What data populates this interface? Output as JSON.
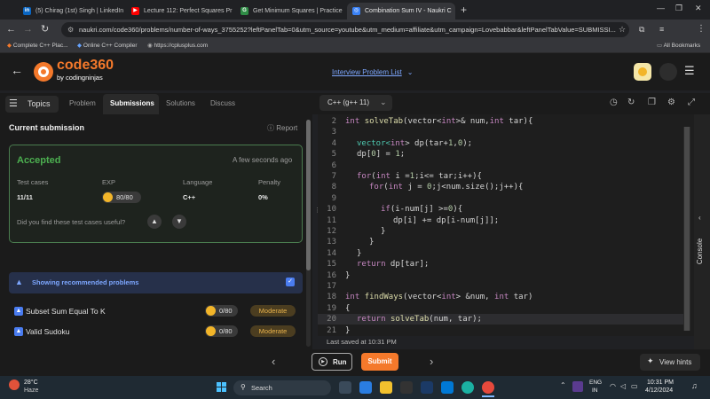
{
  "browser": {
    "tabs": [
      {
        "title": "(5) Chirag (1st) Singh | LinkedIn",
        "color": "#0a66c2",
        "glyph": "in"
      },
      {
        "title": "Lecture 112: Perfect Squares Pr",
        "color": "#ff0000",
        "glyph": "▶"
      },
      {
        "title": "Get Minimum Squares | Practice",
        "color": "#2f8d46",
        "glyph": "G"
      },
      {
        "title": "Combination Sum IV - Naukri C",
        "color": "#3b82f6",
        "glyph": "◎"
      }
    ],
    "new_tab_symbol": "+",
    "url": "naukri.com/code360/problems/number-of-ways_3755252?leftPanelTab=0&utm_source=youtube&utm_medium=affiliate&utm_campaign=Lovebabbar&leftPanelTabValue=SUBMISSI...",
    "bookmarks": [
      "Complete C++ Plac...",
      "Online C++ Compiler",
      "https://cplusplus.com"
    ],
    "all_bookmarks": "All Bookmarks"
  },
  "site": {
    "logo_main": "code360",
    "logo_sub": "by codingninjas",
    "interview_list": "Interview Problem List"
  },
  "problem_tabs": {
    "topics": "Topics",
    "problem": "Problem",
    "submissions": "Submissions",
    "solutions": "Solutions",
    "discuss": "Discuss"
  },
  "language_select": "C++ (g++ 11)",
  "submission": {
    "heading": "Current submission",
    "report": "Report",
    "status": "Accepted",
    "time_ago": "A few seconds ago",
    "test_cases_label": "Test cases",
    "test_cases_value": "11/11",
    "exp_label": "EXP",
    "exp_value": "80/80",
    "language_label": "Language",
    "language_value": "C++",
    "penalty_label": "Penalty",
    "penalty_value": "0%",
    "feedback_question": "Did you find these test cases useful?"
  },
  "recommended": {
    "banner": "Showing recommended problems",
    "items": [
      {
        "name": "Subset Sum Equal To K",
        "exp": "0/80",
        "difficulty": "Moderate"
      },
      {
        "name": "Valid Sudoku",
        "exp": "0/80",
        "difficulty": "Moderate"
      }
    ]
  },
  "editor": {
    "line_numbers": [
      "2",
      "3",
      "4",
      "5",
      "6",
      "7",
      "8",
      "9",
      "10",
      "11",
      "12",
      "13",
      "14",
      "15",
      "16",
      "17",
      "18",
      "19",
      "20",
      "21"
    ],
    "code": {
      "l2a": "int ",
      "l2b": "solveTab",
      "l2c": "(vector<",
      "l2d": "int",
      "l2e": ">& num,",
      "l2f": "int",
      "l2g": " tar){",
      "l4a": "vector<",
      "l4b": "int",
      "l4c": "> dp(tar+",
      "l4d": "1",
      "l4e": ",",
      "l4f": "0",
      "l4g": ");",
      "l5a": "dp[",
      "l5b": "0",
      "l5c": "] = ",
      "l5d": "1",
      "l5e": ";",
      "l7a": "for",
      "l7b": "(",
      "l7c": "int",
      "l7d": " i =",
      "l7e": "1",
      "l7f": ";i<= tar;i++){",
      "l8a": "for",
      "l8b": "(",
      "l8c": "int",
      "l8d": " j = ",
      "l8e": "0",
      "l8f": ";j<num.size();j++){",
      "l10a": "if",
      "l10b": "(i-num[j] >=",
      "l10c": "0",
      "l10d": "){",
      "l11": "dp[i] += dp[i-num[j]];",
      "l12": "}",
      "l13": "}",
      "l14": "}",
      "l15a": "return",
      "l15b": " dp[tar];",
      "l16": "}",
      "l18a": "int ",
      "l18b": "findWays",
      "l18c": "(vector<",
      "l18d": "int",
      "l18e": "> &num, ",
      "l18f": "int",
      "l18g": " tar)",
      "l19": "{",
      "l20a": "return ",
      "l20b": "solveTab",
      "l20c": "(num, tar);",
      "l21": "}"
    },
    "last_saved": "Last saved at 10:31 PM",
    "console": "Console"
  },
  "actions": {
    "run": "Run",
    "submit": "Submit",
    "view_hints": "View hints"
  },
  "taskbar": {
    "temp": "28°C",
    "weather": "Haze",
    "search": "Search",
    "lang1": "ENG",
    "lang2": "IN",
    "time": "10:31 PM",
    "date": "4/12/2024"
  },
  "colors": {
    "accent": "#f4792b",
    "accepted": "#4caf50",
    "link": "#7da7ff"
  }
}
